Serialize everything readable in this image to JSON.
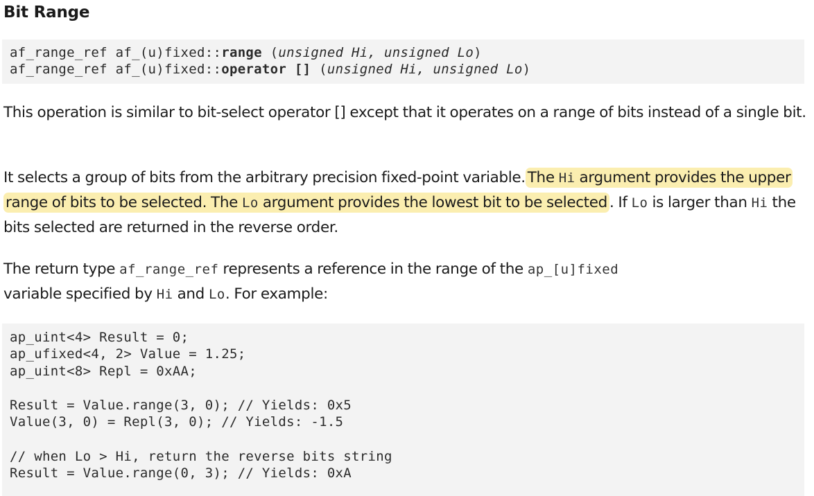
{
  "heading": "Bit Range",
  "signature": {
    "line1": {
      "prefix": "af_range_ref af_(u)fixed::",
      "name": "range",
      "open": " (",
      "args": "unsigned Hi, unsigned Lo",
      "close": ")"
    },
    "line2": {
      "prefix": "af_range_ref af_(u)fixed::",
      "name": "operator []",
      "open": " (",
      "args": "unsigned Hi, unsigned Lo",
      "close": ")"
    }
  },
  "paragraph1": "This operation is similar to bit-select operator [] except that it operates on a range of bits instead of a single bit.",
  "paragraph2": {
    "t1": "It selects a group of bits from the arbitrary precision fixed-point variable.",
    "h1": "The ",
    "h1_code": "Hi",
    "h2": " argument provides the upper range of bits to be selected. The ",
    "h2_code": "Lo",
    "h3": " argument provides the lowest bit to be selected",
    "t2": ". If ",
    "c1": "Lo",
    "t3": " is larger than ",
    "c2": "Hi",
    "t4": " the bits selected are returned in the reverse order."
  },
  "paragraph3": {
    "t1": "The return type ",
    "c1": "af_range_ref",
    "t2": " represents a reference in the range of the ",
    "c2": "ap_[u]fixed",
    "t3": " variable specified by ",
    "c3": "Hi",
    "t4": " and ",
    "c4": "Lo",
    "t5": ". For example:"
  },
  "example_code": [
    "ap_uint<4> Result = 0;",
    "ap_ufixed<4, 2> Value = 1.25;",
    "ap_uint<8> Repl = 0xAA;",
    "",
    "Result = Value.range(3, 0); // Yields: 0x5",
    "Value(3, 0) = Repl(3, 0); // Yields: -1.5",
    "",
    "// when Lo > Hi, return the reverse bits string",
    "Result = Value.range(0, 3); // Yields: 0xA"
  ],
  "colors": {
    "highlight": "#fbeeb0",
    "code_block_bg": "#f3f3f3",
    "text": "#1a1a1a"
  }
}
